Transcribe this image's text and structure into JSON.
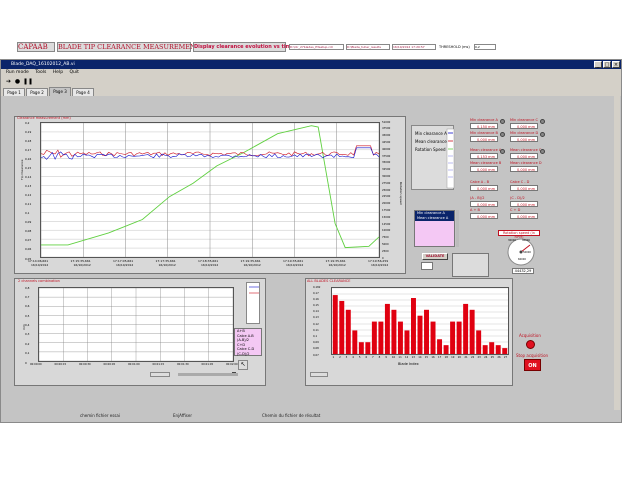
{
  "window": {
    "title": "Blade_DAQ_16102012_AB.vi"
  },
  "menu": [
    "Run mode",
    "Tools",
    "Help",
    "Quit"
  ],
  "tabs": [
    "Page 1",
    "Page 2",
    "Page 3",
    "Page 4"
  ],
  "active_tab": 2,
  "header": {
    "company": "CAPAAB",
    "title": "BLADE TIP CLEARANCE MEASUREMENT",
    "subtitle": "Display clearance evolution vs time",
    "file1": "D:\\Clr_27blades_P3setup.cdl",
    "file2": "D:\\Blade_tuher_results",
    "date": "16/10/2012 17:20:57",
    "threshold_label": "THRESHOLD (ms)",
    "threshold_value": "0,2"
  },
  "chart1": {
    "title": "Clearance measurement (mm)",
    "ylabel": "Tip Clearance",
    "y2label": "Rotation speed",
    "yticks": [
      "0,2",
      "0,19",
      "0,18",
      "0,17",
      "0,16",
      "0,15",
      "0,14",
      "0,13",
      "0,12",
      "0,11",
      "0,1",
      "0,09",
      "0,08",
      "0,07",
      "0,06",
      "0,05"
    ],
    "y2ticks": [
      "51000",
      "47500",
      "45000",
      "42500",
      "40000",
      "37500",
      "35000",
      "32500",
      "30000",
      "27500",
      "25000",
      "22500",
      "20000",
      "17500",
      "15000",
      "12500",
      "10000",
      "7500",
      "5000",
      "2500",
      "0"
    ],
    "xticks": [
      {
        "t": "17:14:06,661",
        "d": "16/10/2012"
      },
      {
        "t": "17:15:35,661",
        "d": "16/10/2012"
      },
      {
        "t": "17:17:05,661",
        "d": "16/10/2012"
      },
      {
        "t": "17:17:35,661",
        "d": "16/10/2012"
      },
      {
        "t": "17:18:35,661",
        "d": "16/10/2012"
      },
      {
        "t": "17:19:35,661",
        "d": "16/10/2012"
      },
      {
        "t": "17:19:35,661",
        "d": "16/10/2012"
      },
      {
        "t": "17:19:35,661",
        "d": "16/10/2012"
      },
      {
        "t": "17:19:56,259",
        "d": "16/10/2012"
      }
    ],
    "legend": [
      "Min clearance A",
      "Mean clearance A",
      "Rotation Speed"
    ],
    "colors": {
      "min": "#1010cc",
      "mean": "#cc1020",
      "speed": "#60d040"
    }
  },
  "chart2": {
    "title": "2 channels combination",
    "ylabel": "mm",
    "yticks": [
      "0,8",
      "0,7",
      "0,6",
      "0,5",
      "0,4",
      "0,3",
      "0,2",
      "0,1",
      "0"
    ],
    "xticks": [
      "00:00:00",
      "00:00:15",
      "00:00:30",
      "00:00:45",
      "00:01:00",
      "00:01:15",
      "00:01:30",
      "00:01:45",
      "00:02:00"
    ],
    "list": [
      "A+B",
      "Calce A-B",
      "(A-B)/2",
      "C+D",
      "Calce C-D",
      "(C-D)/2"
    ]
  },
  "barchart": {
    "title": "ALL BLADES CLEARANCE",
    "xlabel": "Blade Index"
  },
  "chart_data": {
    "type": "bar",
    "title": "ALL BLADES CLEARANCE",
    "xlabel": "Blade Index",
    "ylabel": "",
    "categories": [
      "1",
      "2",
      "3",
      "4",
      "5",
      "6",
      "7",
      "8",
      "9",
      "10",
      "11",
      "12",
      "13",
      "14",
      "15",
      "16",
      "17",
      "18",
      "19",
      "20",
      "21",
      "22",
      "23",
      "24",
      "25",
      "26",
      "27"
    ],
    "values": [
      0.17,
      0.16,
      0.145,
      0.11,
      0.09,
      0.09,
      0.125,
      0.125,
      0.155,
      0.145,
      0.125,
      0.11,
      0.165,
      0.135,
      0.145,
      0.125,
      0.095,
      0.085,
      0.125,
      0.125,
      0.155,
      0.145,
      0.11,
      0.085,
      0.09,
      0.085,
      0.08
    ],
    "yticks": [
      "0,182",
      "0,17",
      "0,16",
      "0,15",
      "0,14",
      "0,13",
      "0,12",
      "0,11",
      "0,1",
      "0,09",
      "0,08",
      "0,07"
    ],
    "ylim": [
      0.07,
      0.182
    ],
    "color": "#e00010",
    "grid": true
  },
  "side": {
    "legend2": [
      "Min clearance A",
      "Mean clearance A"
    ],
    "validate": "VALIDATE",
    "rotation_label": "Rotation speed (in RPM)",
    "rotation_value": "44432,29",
    "gauge_ticks": [
      "30000",
      "40000",
      "50000",
      "60000"
    ]
  },
  "fields": [
    {
      "label": "Min clearance A",
      "value": "0,150 mm"
    },
    {
      "label": "Min clearance C",
      "value": "0,000 mm"
    },
    {
      "label": "Min clearance B",
      "value": "0,000 mm"
    },
    {
      "label": "Min clearance D",
      "value": "0,000 mm"
    },
    {
      "label": "Mean clearance A",
      "value": "0,153 mm"
    },
    {
      "label": "Mean clearance C",
      "value": "0,000 mm"
    },
    {
      "label": "Mean clearance B",
      "value": "0,000 mm"
    },
    {
      "label": "Mean clearance D",
      "value": "0,000 mm"
    },
    {
      "label": "Calce A - B",
      "value": "0,000 mm"
    },
    {
      "label": "Calce C - D",
      "value": "0,000 mm"
    },
    {
      "label": "(A - B)/2",
      "value": "0,000 mm"
    },
    {
      "label": "(C - D)/2",
      "value": "0,000 mm"
    },
    {
      "label": "A + B",
      "value": "0,000 mm"
    },
    {
      "label": "C + D",
      "value": "0,000 mm"
    }
  ],
  "acquisition": {
    "label": "Acquisition",
    "stop_label": "Stop acquisition",
    "on": "ON"
  },
  "bottom": {
    "left": "chemin fichier essai",
    "mid": "EnjAffiser",
    "right": "Chemin du fichier de résultat"
  }
}
